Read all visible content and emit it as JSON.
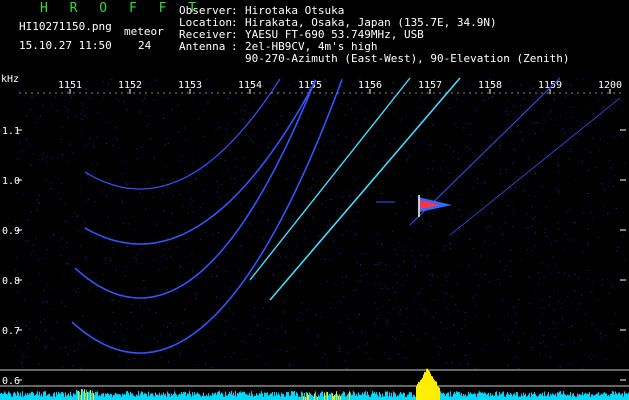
{
  "header": {
    "app_name": "H R O F F T",
    "filename": "HI10271150.png",
    "timestamp": "15.10.27 11:50",
    "meteor_label": "meteor",
    "meteor_count": "24",
    "info_labels": [
      "Observer",
      "Location",
      "Receiver",
      "Antenna",
      ""
    ],
    "info_values": [
      "Hirotaka Otsuka",
      "Hirakata, Osaka, Japan (135.7E, 34.9N)",
      "YAESU FT-690 53.749MHz, USB",
      "2el-HB9CV, 4m's high",
      "90-270-Azimuth (East-West), 90-Elevation (Zenith)"
    ]
  },
  "axes": {
    "y_unit": "kHz",
    "x_ticks": [
      "1151",
      "1152",
      "1153",
      "1154",
      "1155",
      "1156",
      "1157",
      "1158",
      "1159",
      "1200"
    ],
    "y_ticks": [
      "1.1",
      "1.0",
      "0.9",
      "0.8",
      "0.7",
      "0.6"
    ]
  },
  "colors": {
    "background": "#000000",
    "title": "#33dd33",
    "trace_blue": "#3355ff",
    "trace_cyan": "#44ddff",
    "spectrum_cyan": "#00d8ff",
    "spectrum_yellow": "#ffee00"
  }
}
